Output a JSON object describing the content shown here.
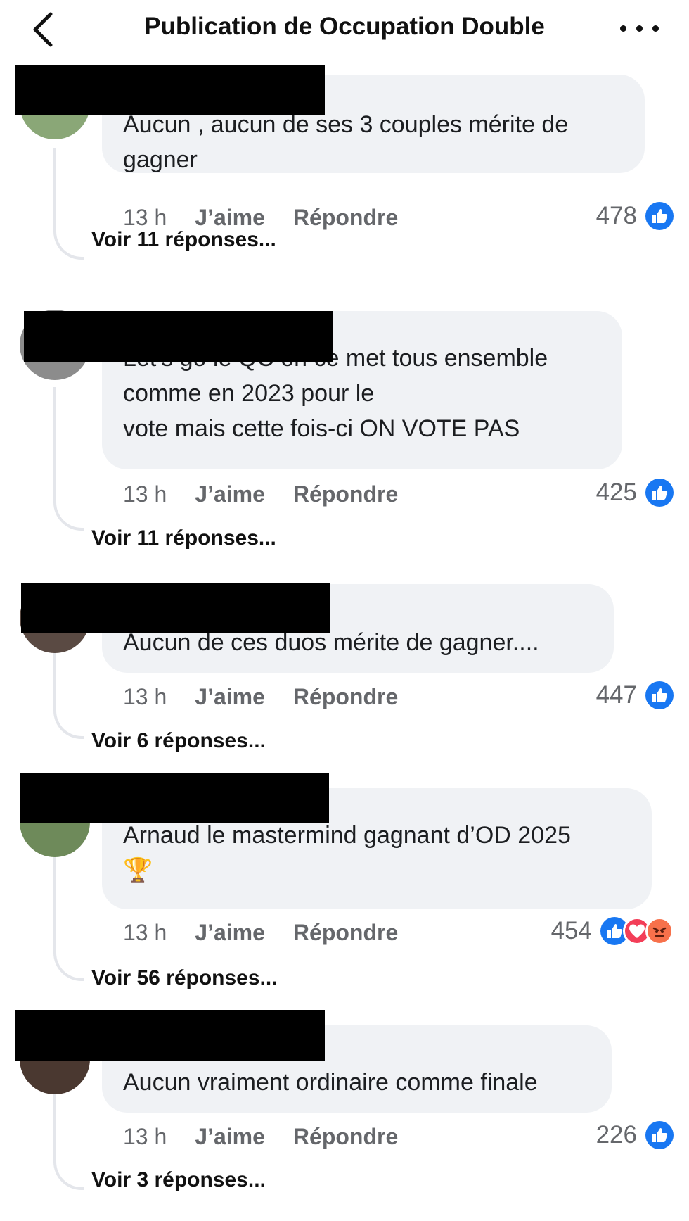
{
  "header": {
    "title": "Publication de Occupation Double"
  },
  "colors": {
    "like": "#1877f2",
    "love": "#f33e58",
    "angry": "#f7714b"
  },
  "comments": [
    {
      "text": "Aucun , aucun de ses 3 couples mérite de gagner",
      "time": "13 h",
      "like_label": "J’aime",
      "reply_label": "Répondre",
      "reaction_count": "478",
      "reactions": [
        "like-icon"
      ],
      "replies_label": "Voir 11 réponses..."
    },
    {
      "text": "Let’s go le QC on ce met tous ensemble comme en 2023 pour le\nvote mais cette fois-ci ON VOTE PAS",
      "time": "13 h",
      "like_label": "J’aime",
      "reply_label": "Répondre",
      "reaction_count": "425",
      "reactions": [
        "like-icon"
      ],
      "replies_label": "Voir 11 réponses..."
    },
    {
      "text": "Aucun de ces duos mérite de gagner....",
      "time": "13 h",
      "like_label": "J’aime",
      "reply_label": "Répondre",
      "reaction_count": "447",
      "reactions": [
        "like-icon"
      ],
      "replies_label": "Voir 6 réponses..."
    },
    {
      "text": "Arnaud le mastermind gagnant d’OD 2025\n🏆",
      "time": "13 h",
      "like_label": "J’aime",
      "reply_label": "Répondre",
      "reaction_count": "454",
      "reactions": [
        "like-icon",
        "love-icon",
        "angry-icon"
      ],
      "replies_label": "Voir 56 réponses..."
    },
    {
      "text": "Aucun vraiment ordinaire comme finale",
      "time": "13 h",
      "like_label": "J’aime",
      "reply_label": "Répondre",
      "reaction_count": "226",
      "reactions": [
        "like-icon"
      ],
      "replies_label": "Voir 3 réponses..."
    }
  ]
}
